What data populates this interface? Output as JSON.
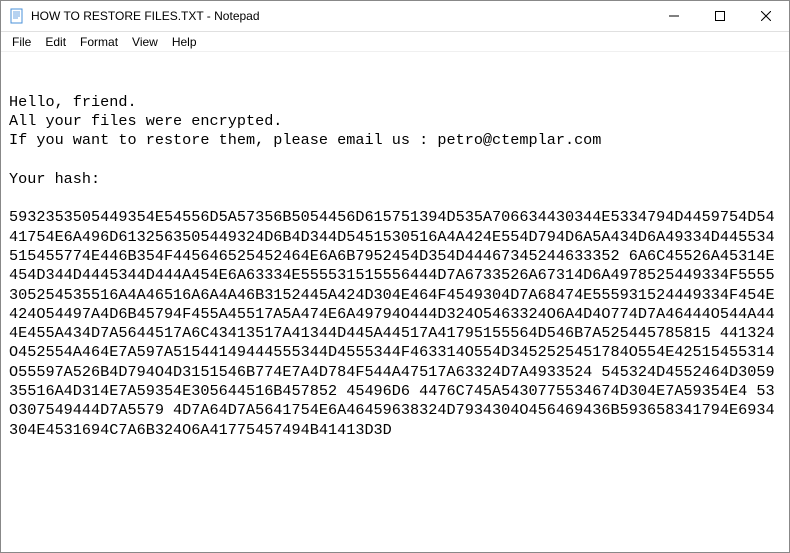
{
  "titlebar": {
    "title": "HOW TO RESTORE FILES.TXT - Notepad"
  },
  "menubar": {
    "file": "File",
    "edit": "Edit",
    "format": "Format",
    "view": "View",
    "help": "Help"
  },
  "content": {
    "greeting": "Hello, friend.",
    "line2": "All your files were encrypted.",
    "line3": "If you want to restore them, please email us : petro@ctemplar.com",
    "hashLabel": "Your hash:",
    "hash": "5932353505449354E54556D5A57356B5054456D615751394D535A706634430344E5334794D4459754D5441754E6A496D6132563505449324D6B4D344D5451530516A4A424E554D794D6A5A434D6A49334D445534515455774E446B354F445646525452464E6A6B7952454D354D44467345244633352 6A6C45526A45314E454D344D4445344D444A454E6A63334E555531515556444D7A6733526A67314D6A4978525449334F5555305254535516A4A46516A6A4A46B3152445A424D304E464F4549304D7A68474E555931524449334F454E424O54497A4D6B45794F455A45517A5A474E6A49794O444D324O5463324O6A4D4O774D7A46444O544A444E455A434D7A5644517A6C43413517A41344D445A44517A41795155564D546B7A525445785815 441324O452554A464E7A597A51544149444555344D4555344F463314O554D3452525451784O554E42515455314O55597A526B4D794O4D3151546B774E7A4D784F544A47517A63324D7A4933524 545324D4552464D305935516A4D314E7A59354E305644516B457852 45496D6 4476C745A5430775534674D304E7A59354E4 53O307549444D7A5579 4D7A64D7A5641754E6A46459638324D7934304O456469436B593658341794E6934304E4531694C7A6B324O6A41775457494B41413D3D"
  }
}
